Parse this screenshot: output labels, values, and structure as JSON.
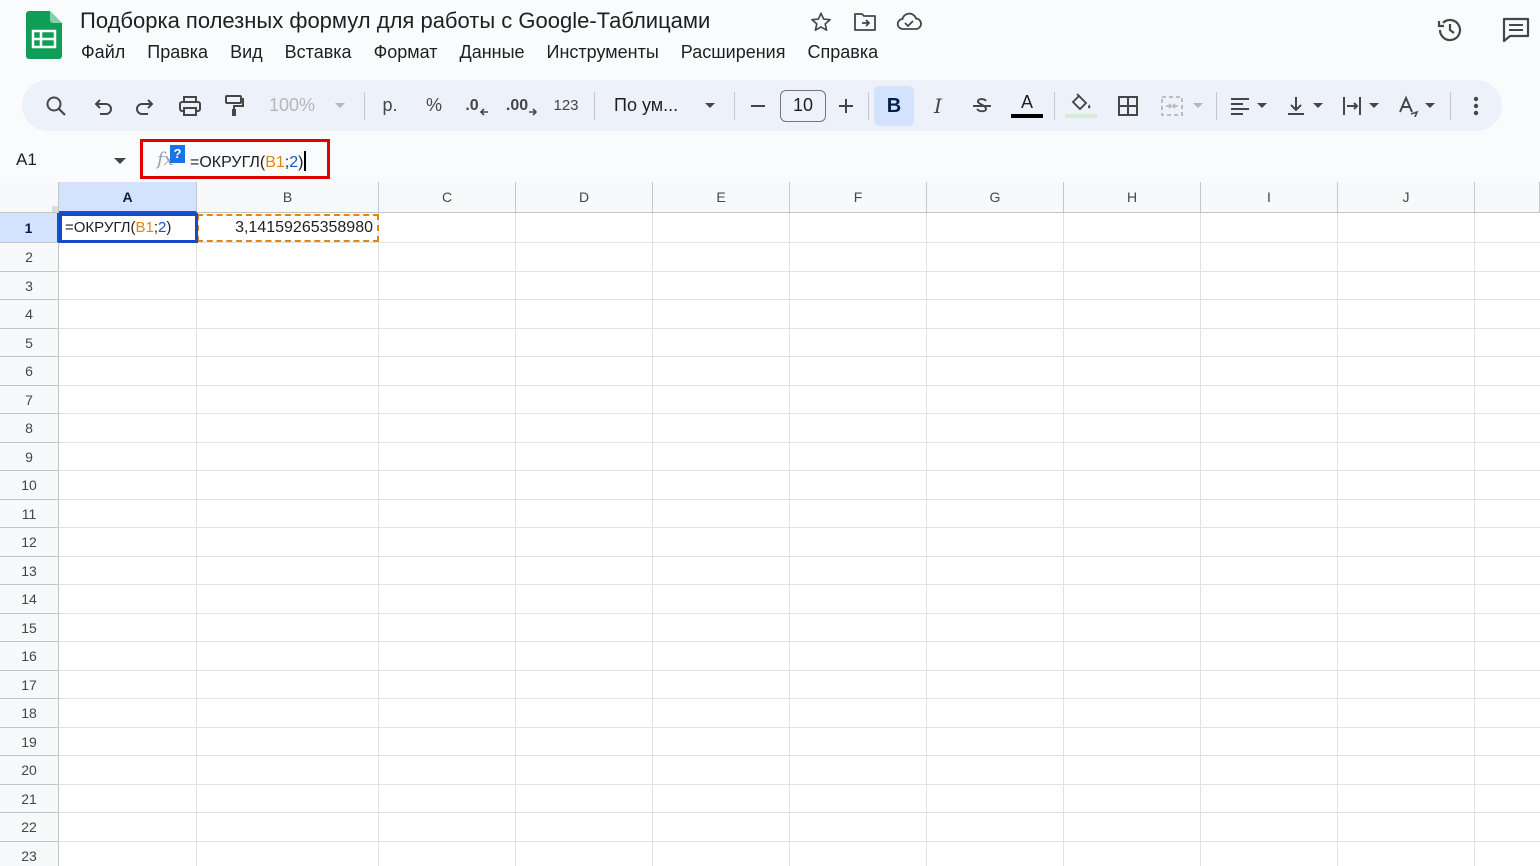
{
  "app": {
    "doc_title": "Подборка полезных формул для работы с Google-Таблицами",
    "title_icons": [
      "star-icon",
      "move-to-folder-icon",
      "cloud-saved-icon"
    ],
    "right_icons": [
      "version-history-icon",
      "comments-icon"
    ]
  },
  "menu": {
    "items": [
      "Файл",
      "Правка",
      "Вид",
      "Вставка",
      "Формат",
      "Данные",
      "Инструменты",
      "Расширения",
      "Справка"
    ]
  },
  "toolbar": {
    "zoom": "100%",
    "currency": "р.",
    "percent": "%",
    "decrease_decimals": ".0",
    "increase_decimals": ".00",
    "more_formats": "123",
    "font": "По ум...",
    "font_size": "10",
    "bold": "B",
    "italic": "I",
    "text_color_letter": "A",
    "text_color": "#000000",
    "fill_color": "#ffffff"
  },
  "formula_bar": {
    "cell_ref": "A1",
    "fx_label": "fx",
    "help_badge": "?",
    "formula_prefix": "=ОКРУГЛ(",
    "formula_ref": "B1",
    "formula_sep": ";",
    "formula_num": "2",
    "formula_suffix": ")"
  },
  "grid": {
    "columns": [
      "A",
      "B",
      "C",
      "D",
      "E",
      "F",
      "G",
      "H",
      "I",
      "J"
    ],
    "rows": [
      "1",
      "2",
      "3",
      "4",
      "5",
      "6",
      "7",
      "8",
      "9",
      "10",
      "11",
      "12",
      "13",
      "14",
      "15",
      "16",
      "17",
      "18",
      "19",
      "20",
      "21",
      "22",
      "23"
    ],
    "selected_column": "A",
    "selected_row": "1",
    "cell_a1": {
      "prefix": "=ОКРУГЛ(",
      "ref": "B1",
      "sep": ";",
      "num": "2",
      "suffix": ")"
    },
    "cell_b1": "3,14159265358980"
  },
  "colors": {
    "accent": "#0b57d0",
    "reference": "#e8830c",
    "highlight_box": "#e00000",
    "sheets_green": "#0f9d58"
  }
}
